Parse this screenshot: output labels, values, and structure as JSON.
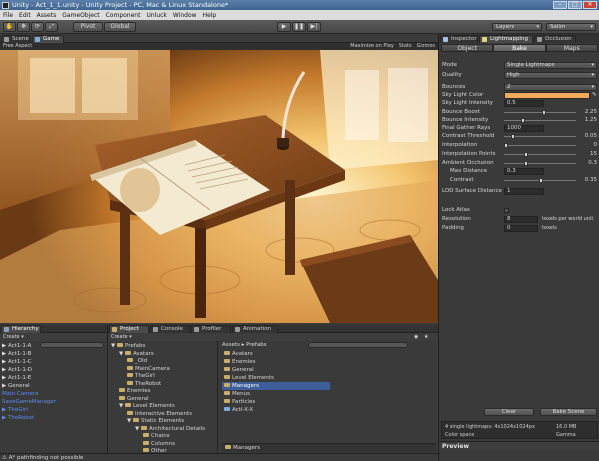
{
  "window": {
    "title": "Unity - Act_1_1.unity - Unity Project - PC, Mac & Linux Standalone*"
  },
  "menu": [
    "File",
    "Edit",
    "Assets",
    "GameObject",
    "Component",
    "Unluck",
    "Window",
    "Help"
  ],
  "toolbar": {
    "pivot": "Pivot",
    "global": "Global",
    "layers": "Layers",
    "layout": "Salim"
  },
  "scene_tabs": {
    "scene": "Scene",
    "game": "Game"
  },
  "game_bar": {
    "aspect": "Free Aspect",
    "maximize": "Maximize on Play",
    "stats": "Stats",
    "gizmos": "Gizmos"
  },
  "inspector": {
    "tabs": {
      "inspector": "Inspector",
      "lightmapping": "Lightmapping",
      "occlusion": "Occlusion"
    },
    "subtabs": [
      "Object",
      "Bake",
      "Maps"
    ],
    "mode": {
      "label": "Mode",
      "value": "Single Lightmaps"
    },
    "quality": {
      "label": "Quality",
      "value": "High"
    },
    "bounces": {
      "label": "Bounces",
      "value": "2"
    },
    "sky_light_color": {
      "label": "Sky Light Color",
      "color": "#f4a95a"
    },
    "sky_light_intensity": {
      "label": "Sky Light Intensity",
      "value": "0.5"
    },
    "bounce_boost": {
      "label": "Bounce Boost",
      "value": "2.25",
      "fraction": 0.56
    },
    "bounce_intensity": {
      "label": "Bounce Intensity",
      "value": "1.25",
      "fraction": 0.25
    },
    "final_gather_rays": {
      "label": "Final Gather Rays",
      "value": "1000"
    },
    "contrast_threshold": {
      "label": "Contrast Threshold",
      "value": "0.05",
      "fraction": 0.1
    },
    "interpolation": {
      "label": "Interpolation",
      "value": "0",
      "fraction": 0.0
    },
    "interpolation_points": {
      "label": "Interpolation Points",
      "value": "15",
      "fraction": 0.3
    },
    "ambient_occlusion": {
      "label": "Ambient Occlusion",
      "value": "0.3",
      "fraction": 0.3
    },
    "max_distance": {
      "label": "Max Distance",
      "value": "0.3"
    },
    "contrast": {
      "label": "Contrast",
      "value": "0.35",
      "fraction": 0.52
    },
    "lod_surface_distance": {
      "label": "LOD Surface Distance",
      "value": "1"
    },
    "lock_atlas": {
      "label": "Lock Atlas"
    },
    "resolution": {
      "label": "Resolution",
      "value": "8",
      "unit": "texels per world unit"
    },
    "padding": {
      "label": "Padding",
      "value": "0",
      "unit": "texels"
    },
    "clear_button": "Clear",
    "bake_button": "Bake Scene",
    "lightmap_info": {
      "count": "4 single lightmaps: 4x1024x1024px",
      "size": "16.0 MB",
      "color_space": "Color space",
      "color_space_value": "Gamma"
    },
    "preview": "Preview"
  },
  "hierarchy": {
    "tab": "Hierarchy",
    "create": "Create",
    "items": [
      {
        "name": "Act1-1-A",
        "blue": false
      },
      {
        "name": "Act1-1-B",
        "blue": false
      },
      {
        "name": "Act1-1-C",
        "blue": false
      },
      {
        "name": "Act1-1-D",
        "blue": false
      },
      {
        "name": "Act1-1-E",
        "blue": false
      },
      {
        "name": "General",
        "blue": false
      },
      {
        "name": "Main Camera",
        "blue": true
      },
      {
        "name": "SaveGameManager",
        "blue": true
      },
      {
        "name": "TheGirl",
        "blue": true
      },
      {
        "name": "TheRobot",
        "blue": true
      }
    ]
  },
  "project": {
    "tabs": {
      "project": "Project",
      "console": "Console",
      "profiler": "Profiler",
      "animation": "Animation"
    },
    "create": "Create",
    "tree": [
      {
        "name": "Prefabs",
        "indent": 0,
        "arrow": "▼"
      },
      {
        "name": "Avatars",
        "indent": 1,
        "arrow": "▼"
      },
      {
        "name": "_Old",
        "indent": 2,
        "arrow": ""
      },
      {
        "name": "MainCamera",
        "indent": 2,
        "arrow": ""
      },
      {
        "name": "TheGirl",
        "indent": 2,
        "arrow": ""
      },
      {
        "name": "TheRobot",
        "indent": 2,
        "arrow": ""
      },
      {
        "name": "Enemies",
        "indent": 1,
        "arrow": ""
      },
      {
        "name": "General",
        "indent": 1,
        "arrow": ""
      },
      {
        "name": "Level Elements",
        "indent": 1,
        "arrow": "▼"
      },
      {
        "name": "Interactive Elements",
        "indent": 2,
        "arrow": ""
      },
      {
        "name": "Static Elements",
        "indent": 2,
        "arrow": "▼"
      },
      {
        "name": "Architectural Details",
        "indent": 3,
        "arrow": "▼"
      },
      {
        "name": "Chains",
        "indent": 4,
        "arrow": ""
      },
      {
        "name": "Columns",
        "indent": 4,
        "arrow": ""
      },
      {
        "name": "Other",
        "indent": 4,
        "arrow": ""
      }
    ],
    "breadcrumb": "Assets ▸ Prefabs",
    "list": [
      {
        "name": "Avatars",
        "selected": false
      },
      {
        "name": "Enemies",
        "selected": false
      },
      {
        "name": "General",
        "selected": false
      },
      {
        "name": "Level Elements",
        "selected": false
      },
      {
        "name": "Managers",
        "selected": true
      },
      {
        "name": "Menus",
        "selected": false
      },
      {
        "name": "Particles",
        "selected": false
      },
      {
        "name": "ActI-X-X",
        "selected": false
      }
    ],
    "footer": "Managers"
  },
  "status": "A* pathfinding not possible"
}
